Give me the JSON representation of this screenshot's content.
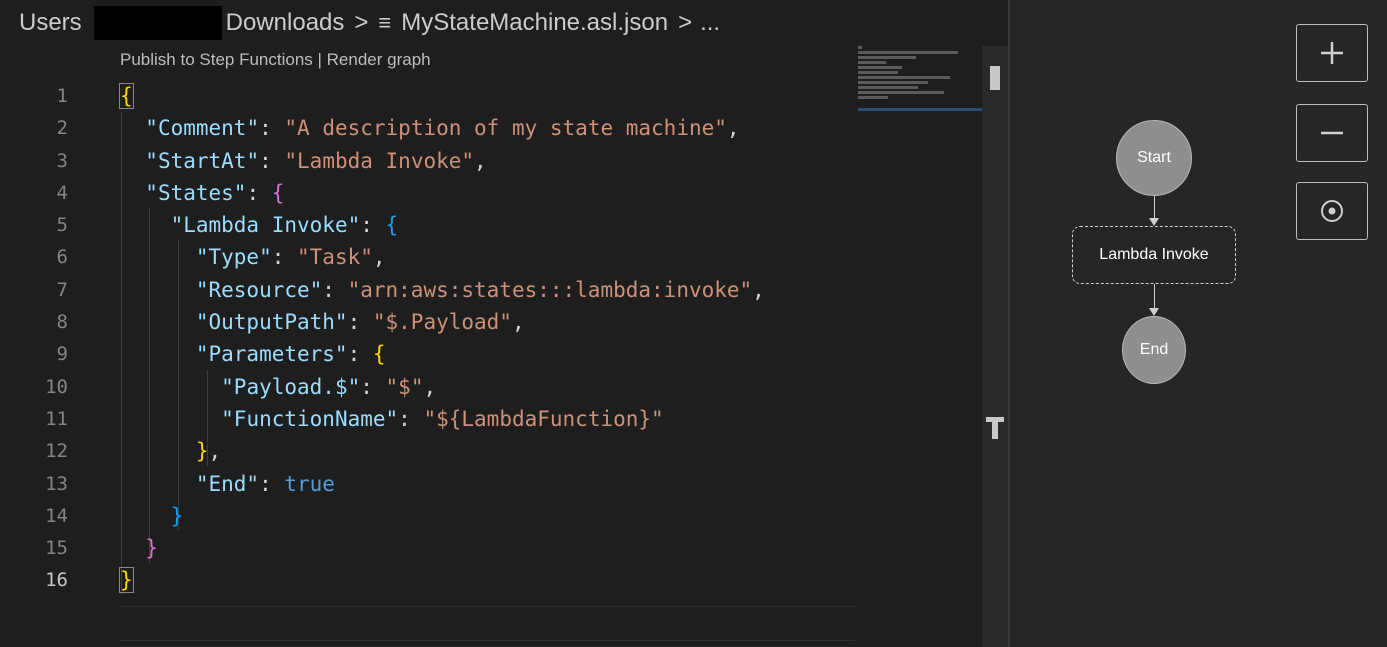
{
  "breadcrumb": {
    "segments": [
      "Users",
      "Downloads",
      "MyStateMachine.asl.json",
      "..."
    ],
    "separator": ">",
    "file_icon": "≡"
  },
  "codelens": {
    "publish_label": "Publish to Step Functions",
    "divider": " | ",
    "render_label": "Render graph"
  },
  "editor": {
    "active_line": 16,
    "line_numbers": [
      "1",
      "2",
      "3",
      "4",
      "5",
      "6",
      "7",
      "8",
      "9",
      "10",
      "11",
      "12",
      "13",
      "14",
      "15",
      "16"
    ],
    "tokens": {
      "comment_key": "\"Comment\"",
      "comment_val": "\"A description of my state machine\"",
      "startat_key": "\"StartAt\"",
      "startat_val": "\"Lambda Invoke\"",
      "states_key": "\"States\"",
      "lambda_key": "\"Lambda Invoke\"",
      "type_key": "\"Type\"",
      "type_val": "\"Task\"",
      "resource_key": "\"Resource\"",
      "resource_val": "\"arn:aws:states:::lambda:invoke\"",
      "outputpath_key": "\"OutputPath\"",
      "outputpath_val": "\"$.Payload\"",
      "parameters_key": "\"Parameters\"",
      "payload_key": "\"Payload.$\"",
      "payload_val": "\"$\"",
      "fn_key": "\"FunctionName\"",
      "fn_val": "\"${LambdaFunction}\"",
      "end_key": "\"End\"",
      "end_val": "true"
    }
  },
  "graph": {
    "nodes": {
      "start": "Start",
      "task": "Lambda Invoke",
      "end": "End"
    },
    "controls": [
      "zoom-in",
      "zoom-out",
      "center"
    ]
  },
  "colors": {
    "string": "#ce9178",
    "key": "#9cdcfe",
    "keyword": "#569cd6",
    "bracket_level1": "#ffd700",
    "bracket_level2": "#da70d6",
    "bracket_level3": "#179fff",
    "graph_node": "#8e8e8e"
  }
}
